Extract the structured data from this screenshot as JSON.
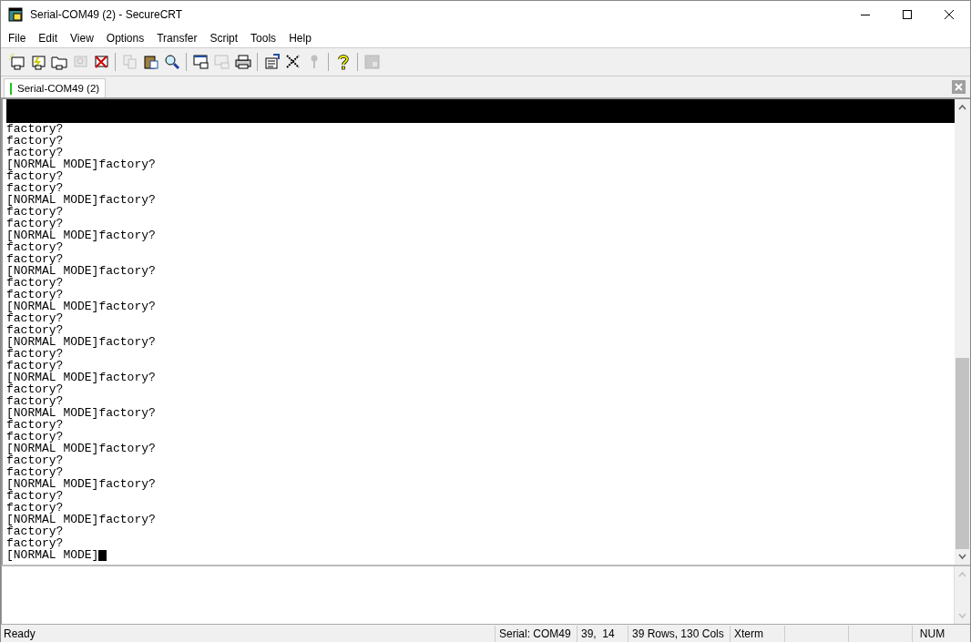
{
  "window": {
    "title": "Serial-COM49 (2) - SecureCRT"
  },
  "menu": [
    "File",
    "Edit",
    "View",
    "Options",
    "Transfer",
    "Script",
    "Tools",
    "Help"
  ],
  "toolbar": [
    [
      {
        "kind": "connect",
        "disabled": false
      },
      {
        "kind": "quick",
        "disabled": false
      },
      {
        "kind": "folder",
        "disabled": false
      },
      {
        "kind": "reconnect",
        "disabled": true
      },
      {
        "kind": "disconnect",
        "disabled": false
      }
    ],
    [
      {
        "kind": "copy",
        "disabled": true
      },
      {
        "kind": "paste",
        "disabled": false
      },
      {
        "kind": "find",
        "disabled": false
      }
    ],
    [
      {
        "kind": "print-screen",
        "disabled": false
      },
      {
        "kind": "print-selection",
        "disabled": true
      },
      {
        "kind": "printer",
        "disabled": false
      }
    ],
    [
      {
        "kind": "options",
        "disabled": false
      },
      {
        "kind": "tools",
        "disabled": false
      },
      {
        "kind": "key",
        "disabled": true
      }
    ],
    [
      {
        "kind": "help",
        "disabled": false
      }
    ],
    [
      {
        "kind": "window",
        "disabled": true
      }
    ]
  ],
  "tabs": [
    {
      "label": "Serial-COM49 (2)",
      "selected": true,
      "connected": true
    }
  ],
  "terminal": {
    "lines": [
      "factory?",
      "factory?",
      "factory?",
      "[NORMAL MODE]factory?",
      "factory?",
      "factory?",
      "[NORMAL MODE]factory?",
      "factory?",
      "factory?",
      "[NORMAL MODE]factory?",
      "factory?",
      "factory?",
      "[NORMAL MODE]factory?",
      "factory?",
      "factory?",
      "[NORMAL MODE]factory?",
      "factory?",
      "factory?",
      "[NORMAL MODE]factory?",
      "factory?",
      "factory?",
      "[NORMAL MODE]factory?",
      "factory?",
      "factory?",
      "[NORMAL MODE]factory?",
      "factory?",
      "factory?",
      "[NORMAL MODE]factory?",
      "factory?",
      "factory?",
      "[NORMAL MODE]factory?",
      "factory?",
      "factory?",
      "[NORMAL MODE]factory?",
      "factory?",
      "factory?",
      "[NORMAL MODE]"
    ],
    "cursor": true
  },
  "status_bar": [
    "Ready",
    "Serial: COM49",
    "39,  14",
    "39 Rows, 130 Cols",
    "Xterm",
    "NUM"
  ]
}
